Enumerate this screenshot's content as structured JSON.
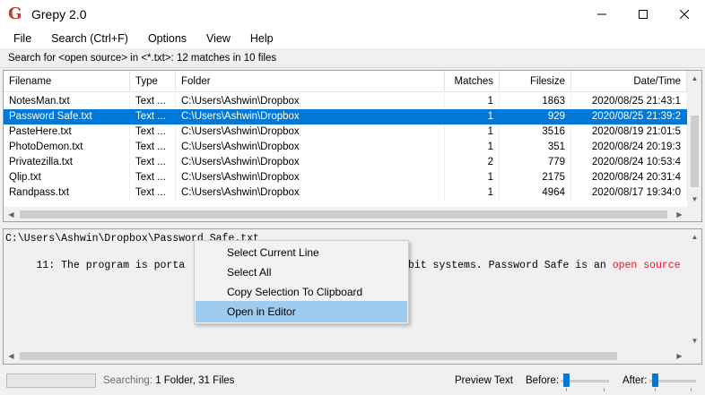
{
  "window": {
    "title": "Grepy 2.0",
    "icon_letter": "G"
  },
  "menu": [
    "File",
    "Search (Ctrl+F)",
    "Options",
    "View",
    "Help"
  ],
  "status": "Search for <open source> in <*.txt>: 12 matches in 10 files",
  "table": {
    "headers": [
      "Filename",
      "Type",
      "Folder",
      "Matches",
      "Filesize",
      "Date/Time"
    ],
    "rows": [
      [
        "NotesMan.txt",
        "Text ...",
        "C:\\Users\\Ashwin\\Dropbox",
        "1",
        "1863",
        "2020/08/25 21:43:1"
      ],
      [
        "Password Safe.txt",
        "Text ...",
        "C:\\Users\\Ashwin\\Dropbox",
        "1",
        "929",
        "2020/08/25 21:39:2"
      ],
      [
        "PasteHere.txt",
        "Text ...",
        "C:\\Users\\Ashwin\\Dropbox",
        "1",
        "3516",
        "2020/08/19 21:01:5"
      ],
      [
        "PhotoDemon.txt",
        "Text ...",
        "C:\\Users\\Ashwin\\Dropbox",
        "1",
        "351",
        "2020/08/24 20:19:3"
      ],
      [
        "Privatezilla.txt",
        "Text ...",
        "C:\\Users\\Ashwin\\Dropbox",
        "2",
        "779",
        "2020/08/24 10:53:4"
      ],
      [
        "Qlip.txt",
        "Text ...",
        "C:\\Users\\Ashwin\\Dropbox",
        "1",
        "2175",
        "2020/08/24 20:31:4"
      ],
      [
        "Randpass.txt",
        "Text ...",
        "C:\\Users\\Ashwin\\Dropbox",
        "1",
        "4964",
        "2020/08/17 19:34:0"
      ]
    ],
    "selected_row": 1
  },
  "preview": {
    "path": "C:\\Users\\Ashwin\\Dropbox\\Password Safe.txt",
    "line_prefix": "     11: The program is porta",
    "line_middle": "4-bit systems. Password Safe is an ",
    "line_highlight": "open source"
  },
  "context_menu": {
    "items": [
      "Select Current Line",
      "Select All",
      "Copy Selection To Clipboard",
      "Open in Editor"
    ],
    "highlighted": 3
  },
  "bottom": {
    "searching_label": "Searching:",
    "searching_value": "1 Folder,  31 Files",
    "preview_text_label": "Preview Text",
    "before_label": "Before:",
    "after_label": "After:"
  },
  "colors": {
    "selection": "#0078d7",
    "highlight_text": "#e81123",
    "menu_hover": "#9fcbee"
  }
}
